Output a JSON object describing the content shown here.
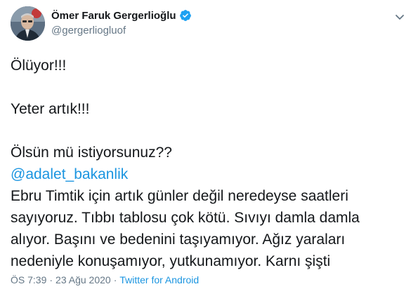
{
  "author": {
    "display_name": "Ömer Faruk Gergerlioğlu",
    "handle": "@gergerliogluof",
    "verified_icon": "verified-badge-icon",
    "avatar_icon": "profile-avatar"
  },
  "more_icon": "chevron-down-icon",
  "tweet": {
    "lines": [
      "Ölüyor!!!",
      "",
      "Yeter artık!!!",
      "",
      "Ölsün mü istiyorsunuz??"
    ],
    "mention": "@adalet_bakanlik",
    "body_lines": [
      "Ebru Timtik için artık günler değil neredeyse saatleri",
      "sayıyoruz. Tıbbı tablosu çok kötü. Sıvıyı damla damla",
      "alıyor. Başını ve bedenini taşıyamıyor. Ağız yaraları",
      "nedeniyle konuşamıyor, yutkunamıyor. Karnı şişti"
    ]
  },
  "meta": {
    "time": "ÖS 7:39",
    "separator": "·",
    "date": "23 Ağu 2020",
    "source": "Twitter for Android"
  },
  "colors": {
    "link": "#1b95e0",
    "text": "#14171a",
    "secondary": "#657786",
    "verified": "#1da1f2"
  }
}
